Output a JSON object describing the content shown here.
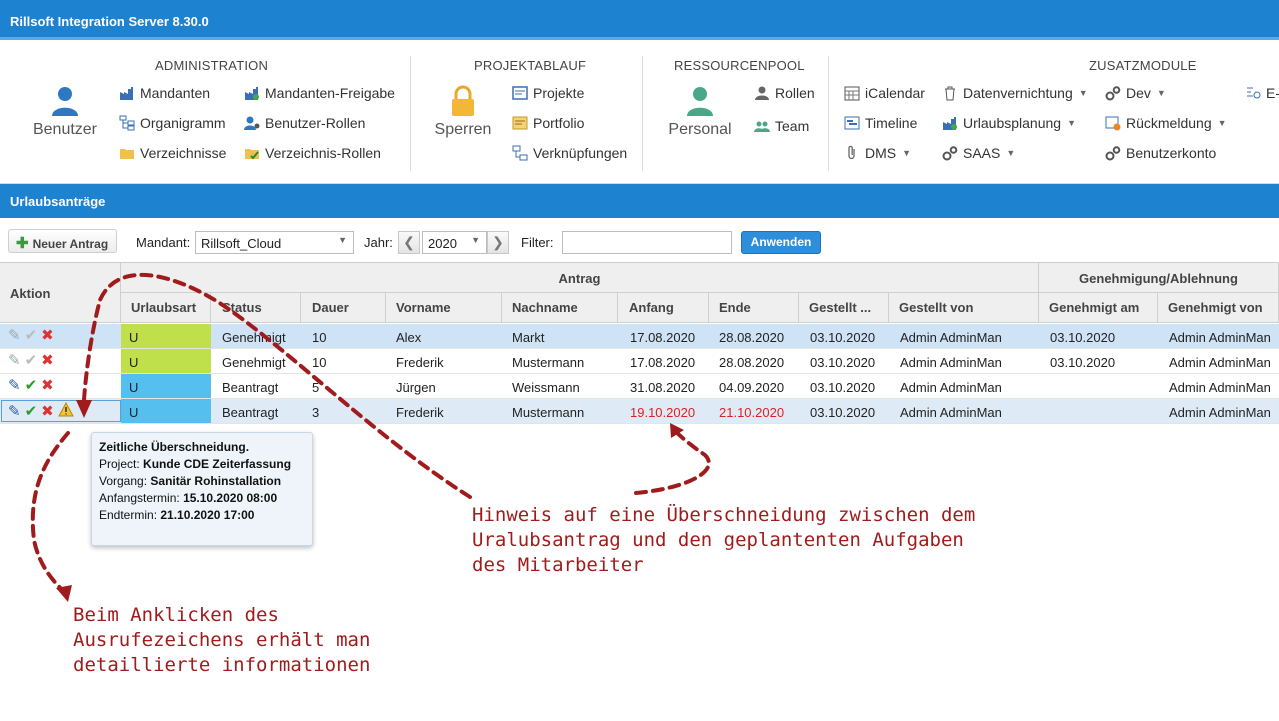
{
  "app": {
    "title": "Rillsoft Integration Server 8.30.0"
  },
  "ribbon": {
    "administration": {
      "title": "ADMINISTRATION",
      "big_label": "Benutzer",
      "items": [
        "Mandanten",
        "Organigramm",
        "Verzeichnisse",
        "Mandanten-Freigabe",
        "Benutzer-Rollen",
        "Verzeichnis-Rollen"
      ]
    },
    "projektablauf": {
      "title": "PROJEKTABLAUF",
      "big_label": "Sperren",
      "items": [
        "Projekte",
        "Portfolio",
        "Verknüpfungen"
      ]
    },
    "ressourcenpool": {
      "title": "RESSOURCENPOOL",
      "big_label": "Personal",
      "items": [
        "Rollen",
        "Team"
      ]
    },
    "zusatzmodule": {
      "title": "ZUSATZMODULE",
      "items": [
        "iCalendar",
        "Timeline",
        "DMS",
        "Datenvernichtung",
        "Urlaubsplanung",
        "SAAS",
        "Dev",
        "Rückmeldung",
        "Benutzerkonto",
        "E-"
      ]
    }
  },
  "section": {
    "title": "Urlaubsanträge"
  },
  "toolbar": {
    "new_label": "Neuer Antrag",
    "mandant_label": "Mandant:",
    "mandant_value": "Rillsoft_Cloud",
    "jahr_label": "Jahr:",
    "jahr_value": "2020",
    "filter_label": "Filter:",
    "filter_value": "",
    "apply_label": "Anwenden"
  },
  "grid": {
    "group_headers": {
      "aktion": "Aktion",
      "antrag": "Antrag",
      "genehmigung": "Genehmigung/Ablehnung"
    },
    "columns": [
      "Urlaubsart",
      "Status",
      "Dauer",
      "Vorname",
      "Nachname",
      "Anfang",
      "Ende",
      "Gestellt ...",
      "Gestellt von",
      "Genehmigt am",
      "Genehmigt von"
    ],
    "rows": [
      {
        "urlaubsart": "U",
        "status": "Genehmigt",
        "dauer": "10",
        "vorname": "Alex",
        "nachname": "Markt",
        "anfang": "17.08.2020",
        "ende": "28.08.2020",
        "gestellt": "03.10.2020",
        "gestellt_von": "Admin AdminMan",
        "genehmigt_am": "03.10.2020",
        "genehmigt_von": "Admin AdminMan"
      },
      {
        "urlaubsart": "U",
        "status": "Genehmigt",
        "dauer": "10",
        "vorname": "Frederik",
        "nachname": "Mustermann",
        "anfang": "17.08.2020",
        "ende": "28.08.2020",
        "gestellt": "03.10.2020",
        "gestellt_von": "Admin AdminMan",
        "genehmigt_am": "03.10.2020",
        "genehmigt_von": "Admin AdminMan"
      },
      {
        "urlaubsart": "U",
        "status": "Beantragt",
        "dauer": "5",
        "vorname": "Jürgen",
        "nachname": "Weissmann",
        "anfang": "31.08.2020",
        "ende": "04.09.2020",
        "gestellt": "03.10.2020",
        "gestellt_von": "Admin AdminMan",
        "genehmigt_am": "",
        "genehmigt_von": "Admin AdminMan"
      },
      {
        "urlaubsart": "U",
        "status": "Beantragt",
        "dauer": "3",
        "vorname": "Frederik",
        "nachname": "Mustermann",
        "anfang": "19.10.2020",
        "ende": "21.10.2020",
        "gestellt": "03.10.2020",
        "gestellt_von": "Admin AdminMan",
        "genehmigt_am": "",
        "genehmigt_von": "Admin AdminMan"
      }
    ]
  },
  "tooltip": {
    "title": "Zeitliche Überschneidung.",
    "project_label": "Project:",
    "project_value": "Kunde CDE Zeiterfassung",
    "vorgang_label": "Vorgang:",
    "vorgang_value": "Sanitär Rohinstallation",
    "start_label": "Anfangstermin:",
    "start_value": "15.10.2020 08:00",
    "end_label": "Endtermin:",
    "end_value": "21.10.2020 17:00"
  },
  "annotations": {
    "overlap_note": [
      "Hinweis auf eine Überschneidung zwischen dem",
      "Uralubsantrag und den geplantenten Aufgaben",
      "des Mitarbeiter"
    ],
    "click_note": [
      "Beim Anklicken des",
      "Ausrufezeichens erhält man",
      "detaillierte informationen"
    ]
  },
  "colors": {
    "header_blue": "#1d82cf",
    "urlaub_approved": "#bfe04a",
    "urlaub_requested": "#55bff0",
    "conflict_red": "#e02020",
    "annotation_red": "#a01c1c"
  }
}
